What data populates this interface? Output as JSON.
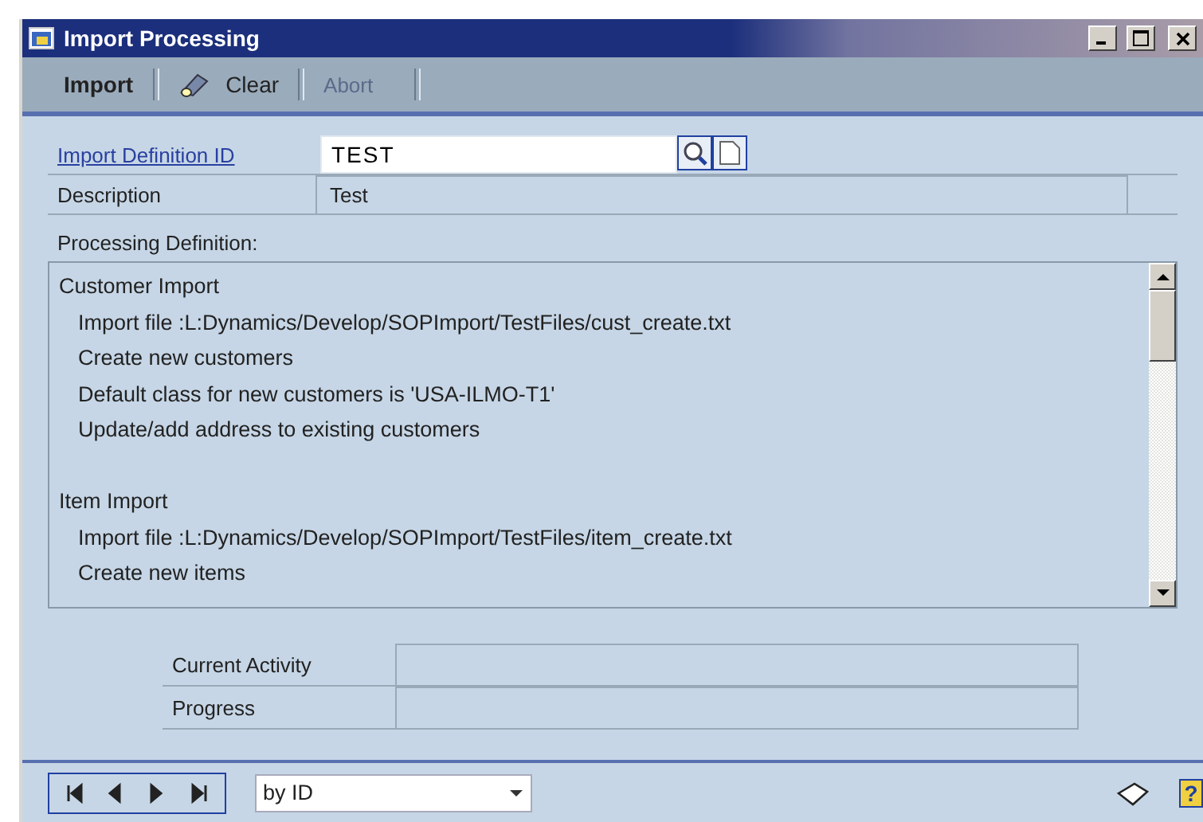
{
  "window": {
    "title": "Import Processing"
  },
  "toolbar": [
    {
      "label": "Import",
      "kind": "primary",
      "disabled": false
    },
    {
      "label": "Clear",
      "kind": "icon",
      "disabled": false
    },
    {
      "label": "Abort",
      "kind": "plain",
      "disabled": true
    }
  ],
  "import_definition_id": {
    "label": "Import Definition ID",
    "value": "TEST"
  },
  "description": {
    "label": "Description",
    "value": "Test"
  },
  "processing_definition": {
    "label": "Processing Definition:",
    "lines": [
      {
        "text": "Customer Import",
        "children": [
          {
            "text": "Import file :L:Dynamics/Develop/SOPImport/TestFiles/cust_create.txt"
          },
          {
            "text": "Create new customers"
          },
          {
            "text": "Default class for new customers is 'USA-ILMO-T1'"
          },
          {
            "text": "Update/add address to existing customers"
          }
        ]
      },
      {
        "text": "Item Import",
        "children": [
          {
            "text": "Import file :L:Dynamics/Develop/SOPImport/TestFiles/item_create.txt"
          },
          {
            "text": "Create new items"
          }
        ]
      }
    ]
  },
  "status": [
    {
      "label": "Current Activity"
    },
    {
      "label": "Progress"
    }
  ],
  "footer": {
    "sort": "by ID",
    "help": "?"
  }
}
